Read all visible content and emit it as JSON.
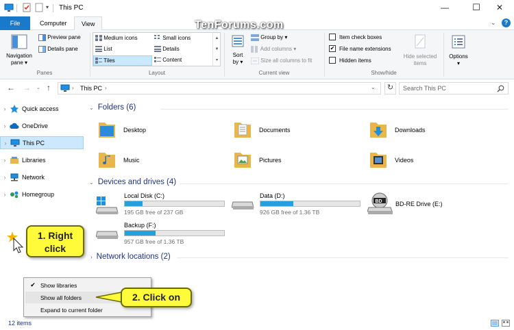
{
  "window": {
    "title": "This PC",
    "minimize": "—",
    "maximize": "☐",
    "close": "✕"
  },
  "watermark": "TenForums.com",
  "tabs": {
    "file": "File",
    "computer": "Computer",
    "view": "View"
  },
  "ribbon": {
    "panes": {
      "navigation_pane": "Navigation",
      "navigation_pane2": "pane ▾",
      "preview_pane": "Preview pane",
      "details_pane": "Details pane",
      "label": "Panes"
    },
    "layout": {
      "medium_icons": "Medium icons",
      "small_icons": "Small icons",
      "list": "List",
      "details": "Details",
      "tiles": "Tiles",
      "content": "Content",
      "label": "Layout"
    },
    "current_view": {
      "sort_by": "Sort",
      "sort_by2": "by ▾",
      "group_by": "Group by ▾",
      "add_columns": "Add columns ▾",
      "size_all_columns": "Size all columns to fit",
      "label": "Current view"
    },
    "show_hide": {
      "item_check_boxes": "Item check boxes",
      "file_name_extensions": "File name extensions",
      "hidden_items": "Hidden items",
      "hide_selected": "Hide selected",
      "hide_selected2": "items",
      "label": "Show/hide"
    },
    "options": {
      "label": "Options",
      "arrow": "▾"
    }
  },
  "address": {
    "path": "This PC",
    "search_placeholder": "Search This PC"
  },
  "nav": {
    "items": [
      {
        "label": "Quick access"
      },
      {
        "label": "OneDrive"
      },
      {
        "label": "This PC"
      },
      {
        "label": "Libraries"
      },
      {
        "label": "Network"
      },
      {
        "label": "Homegroup"
      }
    ]
  },
  "content": {
    "folders_header": "Folders (6)",
    "folders": [
      "Desktop",
      "Documents",
      "Downloads",
      "Music",
      "Pictures",
      "Videos"
    ],
    "drives_header": "Devices and drives (4)",
    "drives": [
      {
        "name": "Local Disk (C:)",
        "free": "195 GB free of 237 GB",
        "used_fraction": 0.18
      },
      {
        "name": "Data (D:)",
        "free": "926 GB free of 1.36 TB",
        "used_fraction": 0.33
      },
      {
        "name": "BD-RE Drive (E:)"
      },
      {
        "name": "Backup (F:)",
        "free": "957 GB free of 1.36 TB",
        "used_fraction": 0.31
      }
    ],
    "network_header": "Network locations (2)"
  },
  "status": {
    "items": "12 items"
  },
  "context_menu": {
    "items": [
      {
        "label": "Show libraries",
        "checked": true
      },
      {
        "label": "Show all folders",
        "checked": false
      },
      {
        "label": "Expand to current folder",
        "checked": false
      }
    ]
  },
  "callouts": {
    "step1_line1": "1. Right",
    "step1_line2": "click",
    "step2": "2. Click on"
  },
  "colors": {
    "accent": "#1979ca",
    "section_header": "#1e3287",
    "drive_fill": "#26a0da",
    "callout": "#fffb3a"
  }
}
